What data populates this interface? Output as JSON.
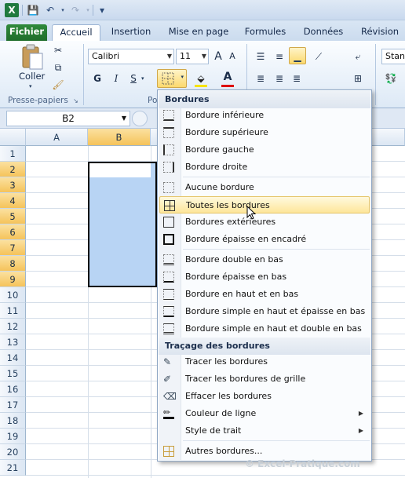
{
  "titlebar": {
    "logo": "X",
    "save": "💾",
    "undo": "↶",
    "redo": "↷",
    "customize": "▾"
  },
  "tabs": [
    "Fichier",
    "Accueil",
    "Insertion",
    "Mise en page",
    "Formules",
    "Données",
    "Révision"
  ],
  "ribbon": {
    "paste_label": "Coller",
    "clipboard_group": "Presse-papiers",
    "police_group_partial": "Po",
    "font_name": "Calibri",
    "font_size": "11",
    "grow": "A",
    "shrink": "A",
    "bold": "G",
    "italic": "I",
    "underline": "S",
    "number_format_partial": "Stand"
  },
  "formula_bar": {
    "name_box": "B2"
  },
  "grid": {
    "columns": [
      "A",
      "B"
    ],
    "selected_column": "B",
    "rows": [
      "1",
      "2",
      "3",
      "4",
      "5",
      "6",
      "7",
      "8",
      "9",
      "10",
      "11",
      "12",
      "13",
      "14",
      "15",
      "16",
      "17",
      "18",
      "19",
      "20",
      "21"
    ],
    "selected_rows": [
      "2",
      "3",
      "4",
      "5",
      "6",
      "7",
      "8",
      "9"
    ]
  },
  "menu": {
    "section1": "Bordures",
    "section2": "Traçage des bordures",
    "items1": [
      "Bordure inférieure",
      "Bordure supérieure",
      "Bordure gauche",
      "Bordure droite",
      "Aucune bordure",
      "Toutes les bordures",
      "Bordures extérieures",
      "Bordure épaisse en encadré",
      "Bordure double en bas",
      "Bordure épaisse en bas",
      "Bordure en haut et en bas",
      "Bordure simple en haut et épaisse en bas",
      "Bordure simple en haut et double en bas"
    ],
    "items2": [
      "Tracer les bordures",
      "Tracer les bordures de grille",
      "Effacer les bordures",
      "Couleur de ligne",
      "Style de trait"
    ],
    "more": "Autres bordures...",
    "highlighted": "Toutes les bordures"
  },
  "watermark": "© Excel-Pratique.com",
  "colors": {
    "selection": "#b8d4f4",
    "file_tab": "#2f8a3b",
    "highlight": "#fde69a"
  }
}
